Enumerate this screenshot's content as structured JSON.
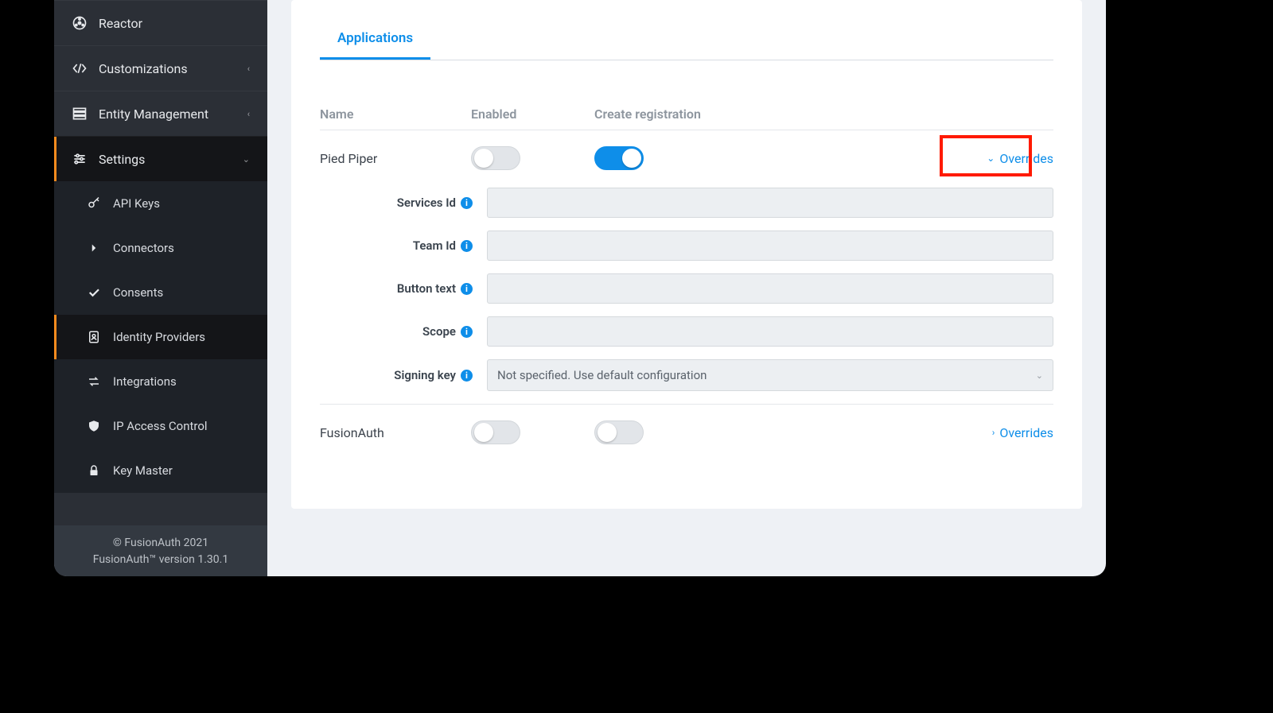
{
  "sidebar": {
    "reactor": "Reactor",
    "customizations": "Customizations",
    "entity": "Entity Management",
    "settings": "Settings",
    "items": [
      "API Keys",
      "Connectors",
      "Consents",
      "Identity Providers",
      "Integrations",
      "IP Access Control",
      "Key Master"
    ]
  },
  "footer": {
    "copyright": "© FusionAuth 2021",
    "version": "FusionAuth™ version 1.30.1"
  },
  "tabs": {
    "applications": "Applications"
  },
  "headers": {
    "name": "Name",
    "enabled": "Enabled",
    "create": "Create registration"
  },
  "rows": {
    "r1": {
      "name": "Pied Piper",
      "overrides": "Overrides"
    },
    "r2": {
      "name": "FusionAuth",
      "overrides": "Overrides"
    }
  },
  "form": {
    "servicesId": "Services Id",
    "teamId": "Team Id",
    "button": "Button text",
    "scope": "Scope",
    "signingKey": "Signing key",
    "signingValue": "Not specified. Use default configuration"
  },
  "info_glyph": "i"
}
